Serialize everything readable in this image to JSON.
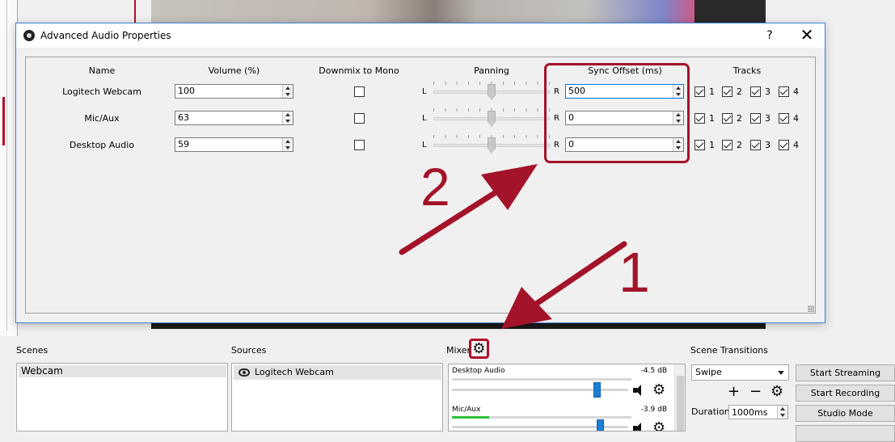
{
  "dialog": {
    "title": "Advanced Audio Properties",
    "help_label": "?",
    "close_label": "✕"
  },
  "columns": {
    "name": "Name",
    "volume": "Volume (%)",
    "downmix": "Downmix to Mono",
    "panning": "Panning",
    "sync": "Sync Offset (ms)",
    "tracks": "Tracks"
  },
  "pan_labels": {
    "left": "L",
    "right": "R"
  },
  "sources": [
    {
      "name": "Logitech Webcam",
      "volume": "100",
      "downmix": false,
      "sync": "500",
      "tracks": [
        true,
        true,
        true,
        true
      ]
    },
    {
      "name": "Mic/Aux",
      "volume": "63",
      "downmix": false,
      "sync": "0",
      "tracks": [
        true,
        true,
        true,
        true
      ]
    },
    {
      "name": "Desktop Audio",
      "volume": "59",
      "downmix": false,
      "sync": "0",
      "tracks": [
        true,
        true,
        true,
        true
      ]
    }
  ],
  "track_numbers": [
    "1",
    "2",
    "3",
    "4"
  ],
  "annotations": {
    "step1": "1",
    "step2": "2",
    "color": "#a31329"
  },
  "main": {
    "scenes_title": "Scenes",
    "scenes": [
      "Webcam"
    ],
    "sources_title": "Sources",
    "sources": [
      "Logitech Webcam"
    ],
    "mixer_title": "Mixer",
    "mixer": [
      {
        "name": "Desktop Audio",
        "db": "-4.5 dB"
      },
      {
        "name": "Mic/Aux",
        "db": "-3.9 dB"
      }
    ],
    "transitions_title": "Scene Transitions",
    "transition": "Swipe",
    "add_label": "+",
    "remove_label": "−",
    "duration_label": "Duration",
    "duration_value": "1000ms",
    "buttons": {
      "start_streaming": "Start Streaming",
      "start_recording": "Start Recording",
      "studio_mode": "Studio Mode"
    }
  },
  "icons": {
    "gear": "gear-icon",
    "speaker": "speaker-icon",
    "eye": "eye-icon",
    "app": "obs-logo-icon"
  }
}
